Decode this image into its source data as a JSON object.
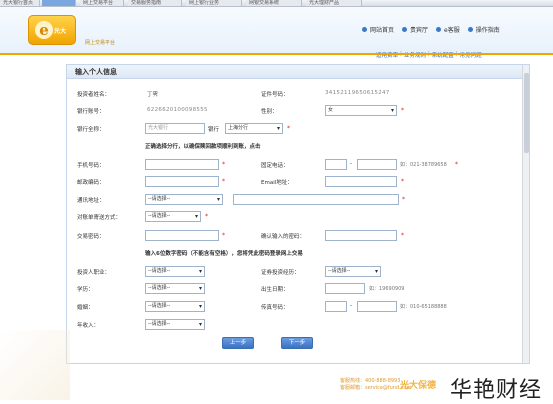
{
  "browser": {
    "tabs": [
      "光大银行首页",
      "",
      "网上交易平台",
      "交易服务指南",
      "网上银行业务",
      "网银交易系统",
      "光大理财产品"
    ]
  },
  "header": {
    "logo_text": "光大",
    "logo_sub": "网上交易平台",
    "nav": [
      "网站首页",
      "贵宾厅",
      "e客服",
      "操作指南"
    ],
    "subnav": [
      "适用费率",
      "业务规则",
      "系统配置",
      "常见问题"
    ]
  },
  "panel": {
    "title": "输入个人信息"
  },
  "form": {
    "name_label": "投资者姓名：",
    "name_value": "丁霁",
    "cert_label": "证件号码：",
    "cert_value": "34152119650615247",
    "account_label": "银行账号：",
    "account_value": "6226620100098555",
    "gender_label": "性别：",
    "gender_value": "女",
    "bank_label": "银行全称：",
    "bank_placeholder": "光大银行",
    "bank_mid": "银行",
    "branch_value": "上海分行",
    "notice1": "正确选择分行，以确保赎回款项顺利到账，点击",
    "mobile_label": "手机号码：",
    "phone_label": "固定电话：",
    "phone_hint": "如：021-38789658",
    "zip_label": "邮政编码：",
    "email_label": "Email地址：",
    "address_label": "通讯地址：",
    "address_select": "--请选择--",
    "statement_label": "对账单寄送方式：",
    "statement_select": "--请选择--",
    "trade_pwd_label": "交易密码：",
    "confirm_pwd_label": "确认输入的密码：",
    "notice2": "输入6位数字密码（不能含有空格），您将凭此密码登录网上交易",
    "occupation_label": "投资人职业：",
    "occupation_select": "--请选择--",
    "experience_label": "证券投资经历：",
    "experience_select": "--请选择--",
    "education_label": "学历：",
    "education_select": "--请选择--",
    "birth_label": "出生日期：",
    "birth_hint": "如：19690909",
    "marriage_label": "婚姻：",
    "marriage_select": "--请选择--",
    "fax_label": "传真号码：",
    "fax_hint": "如：010-65188888",
    "income_label": "年收入：",
    "income_select": "--请选择--",
    "dash": "-"
  },
  "buttons": {
    "prev": "上一步",
    "next": "下一步"
  },
  "footer": {
    "line1": "客服热线：400-888-8993",
    "line2": "客服邮箱：service@fund.com",
    "brand": "光大保德"
  },
  "watermark": "华艳财经",
  "colors": {
    "accent": "#f0a400",
    "link": "#1f5fb8",
    "button": "#3a72c2",
    "required": "#e02020"
  }
}
